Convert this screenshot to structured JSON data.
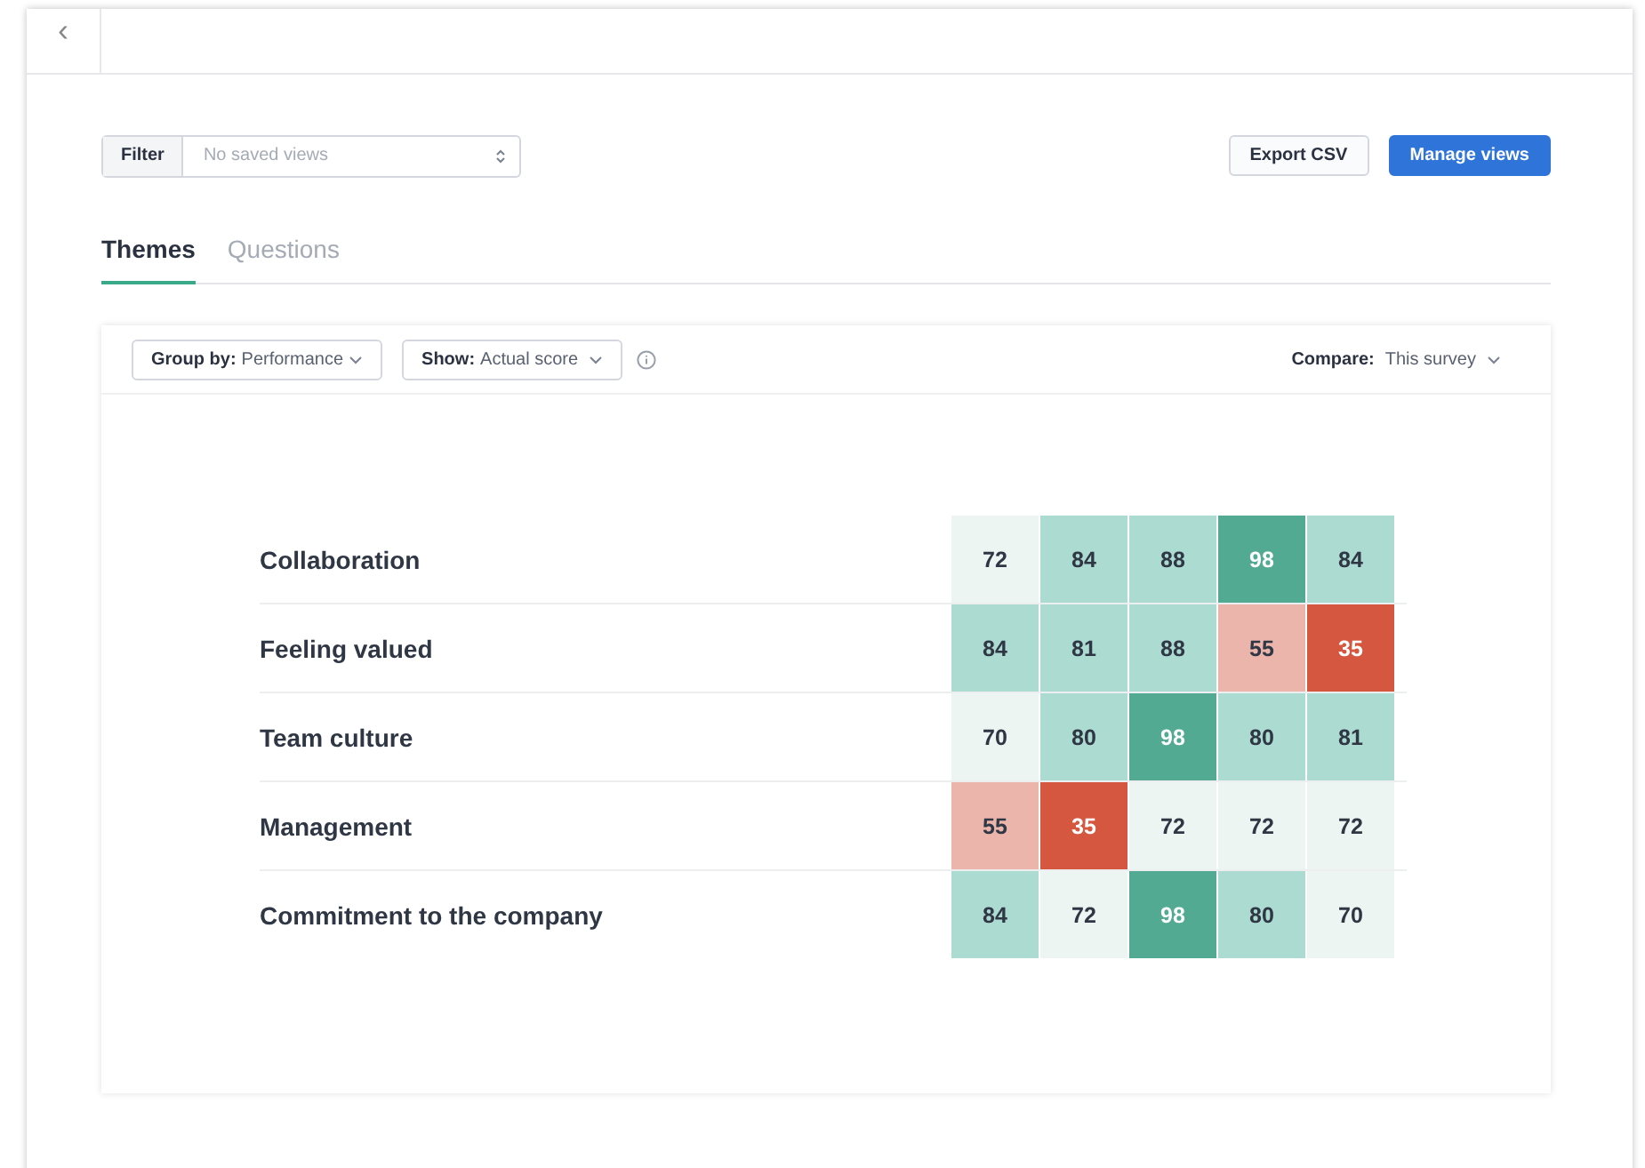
{
  "back_button": {
    "label": "‹"
  },
  "filter": {
    "label": "Filter",
    "placeholder": "No saved views"
  },
  "actions": [
    {
      "label": "Export CSV",
      "kind": "secondary"
    },
    {
      "label": "Manage views",
      "kind": "primary"
    }
  ],
  "tabs": [
    {
      "label": "Themes",
      "selected": true
    },
    {
      "label": "Questions",
      "selected": false
    }
  ],
  "toolbar": {
    "group_by": {
      "label": "Group by:",
      "value": "Performance"
    },
    "show": {
      "label": "Show:",
      "value": "Actual score"
    },
    "compare": {
      "label": "Compare:",
      "value": "This survey"
    }
  },
  "rows": [
    {
      "name": "Collaboration",
      "cells": [
        {
          "value": "72",
          "color": "#ecf5f2"
        },
        {
          "value": "84",
          "color": "#acdbd2"
        },
        {
          "value": "88",
          "color": "#acdbd2"
        },
        {
          "value": "98",
          "color": "#52aa93"
        },
        {
          "value": "84",
          "color": "#acdbd2"
        }
      ]
    },
    {
      "name": "Feeling valued",
      "cells": [
        {
          "value": "84",
          "color": "#acdbd2"
        },
        {
          "value": "81",
          "color": "#acdbd2"
        },
        {
          "value": "88",
          "color": "#acdbd2"
        },
        {
          "value": "55",
          "color": "#ebb5ac"
        },
        {
          "value": "35",
          "color": "#d5573f"
        }
      ]
    },
    {
      "name": "Team culture",
      "cells": [
        {
          "value": "70",
          "color": "#ecf5f2"
        },
        {
          "value": "80",
          "color": "#acdbd2"
        },
        {
          "value": "98",
          "color": "#52aa93"
        },
        {
          "value": "80",
          "color": "#acdbd2"
        },
        {
          "value": "81",
          "color": "#acdbd2"
        }
      ]
    },
    {
      "name": "Management",
      "cells": [
        {
          "value": "55",
          "color": "#ebb5ac"
        },
        {
          "value": "35",
          "color": "#d5573f"
        },
        {
          "value": "72",
          "color": "#ecf5f2"
        },
        {
          "value": "72",
          "color": "#ecf5f2"
        },
        {
          "value": "72",
          "color": "#ecf5f2"
        }
      ]
    },
    {
      "name": "Commitment to the company",
      "cells": [
        {
          "value": "84",
          "color": "#acdbd2"
        },
        {
          "value": "72",
          "color": "#ecf5f2"
        },
        {
          "value": "98",
          "color": "#52aa93"
        },
        {
          "value": "80",
          "color": "#acdbd2"
        },
        {
          "value": "70",
          "color": "#ecf5f2"
        }
      ]
    }
  ]
}
